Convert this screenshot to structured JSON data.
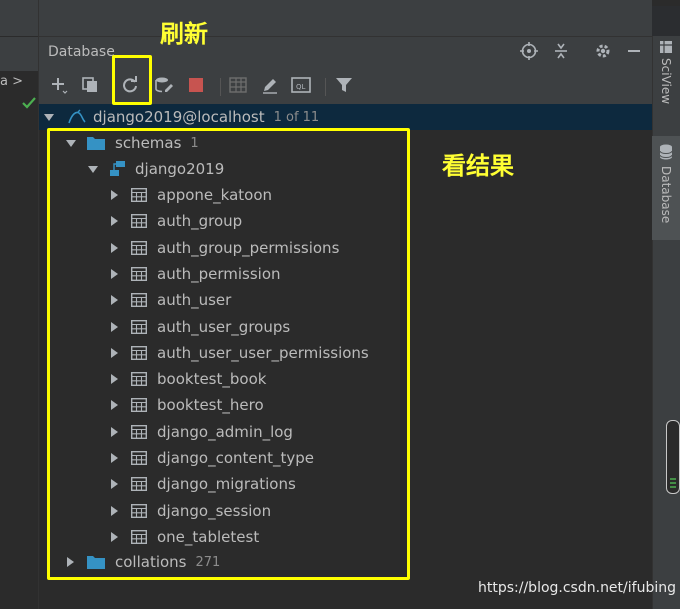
{
  "annotations": {
    "refresh_label": "刷新",
    "result_label": "看结果"
  },
  "left_editor": {
    "tab_text": "a >"
  },
  "panel": {
    "title": "Database"
  },
  "toolbar": {
    "icons": [
      "add-icon",
      "duplicate-icon",
      "refresh-icon",
      "datasource-properties-icon",
      "stop-icon",
      "table-view-icon",
      "edit-icon",
      "sql-console-icon",
      "filter-icon"
    ],
    "header_icons": [
      "crosshair-icon",
      "collapse-icon",
      "gear-icon",
      "minimize-icon"
    ]
  },
  "tree": {
    "datasource": {
      "label": "django2019@localhost",
      "count": "1 of 11"
    },
    "schemas": {
      "label": "schemas",
      "count": "1"
    },
    "schema": {
      "label": "django2019"
    },
    "tables": [
      "appone_katoon",
      "auth_group",
      "auth_group_permissions",
      "auth_permission",
      "auth_user",
      "auth_user_groups",
      "auth_user_user_permissions",
      "booktest_book",
      "booktest_hero",
      "django_admin_log",
      "django_content_type",
      "django_migrations",
      "django_session",
      "one_tabletest"
    ],
    "collations": {
      "label": "collations",
      "count": "271"
    }
  },
  "right_tabs": {
    "sciview": "SciView",
    "database": "Database"
  },
  "watermark": "https://blog.csdn.net/ifubing",
  "colors": {
    "accent_yellow": "#ffff00",
    "selection": "#0d293e",
    "folder_blue": "#3592c4",
    "stop_red": "#c75450"
  }
}
